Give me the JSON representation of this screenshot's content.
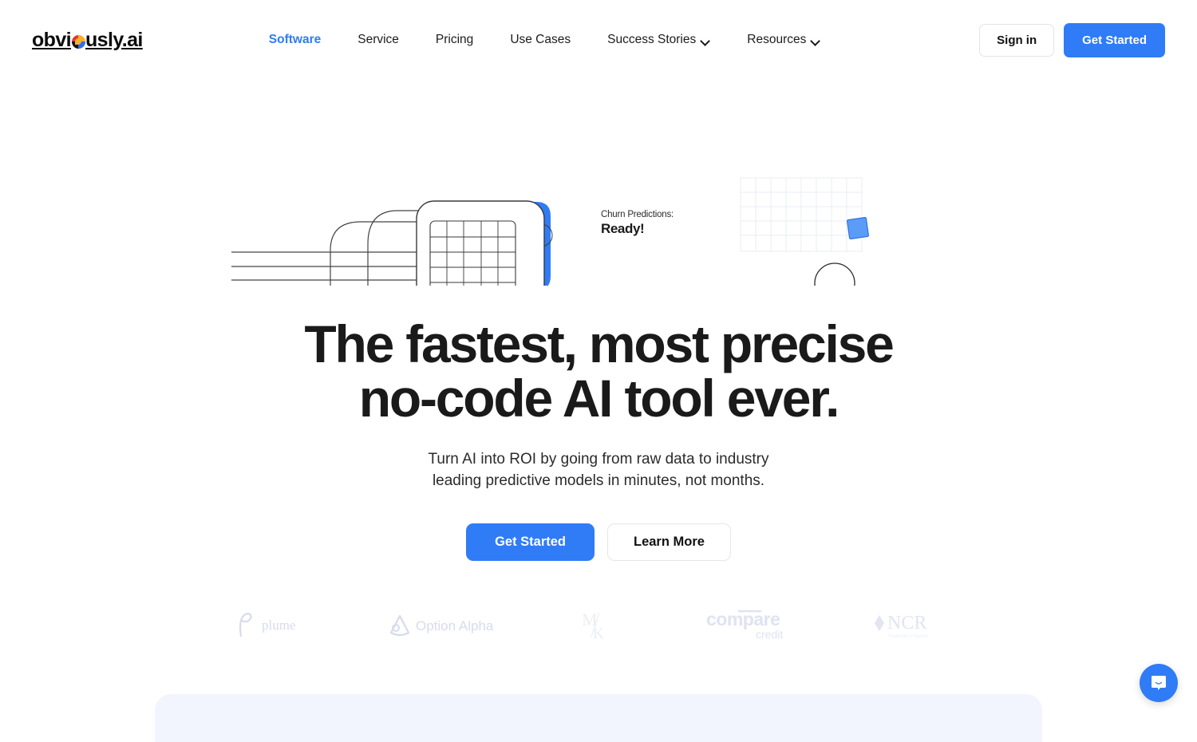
{
  "brand": {
    "text_before": "obvi",
    "mark": "colorful-circle-logomark",
    "text_after": "usly.ai",
    "full": "obviously.ai"
  },
  "nav": {
    "items": [
      {
        "label": "Software",
        "active": true,
        "has_dropdown": false
      },
      {
        "label": "Service",
        "active": false,
        "has_dropdown": false
      },
      {
        "label": "Pricing",
        "active": false,
        "has_dropdown": false
      },
      {
        "label": "Use Cases",
        "active": false,
        "has_dropdown": false
      },
      {
        "label": "Success Stories",
        "active": false,
        "has_dropdown": true
      },
      {
        "label": "Resources",
        "active": false,
        "has_dropdown": true
      }
    ]
  },
  "header_actions": {
    "signin_label": "Sign in",
    "get_started_label": "Get Started"
  },
  "illustration": {
    "screen_label": "Churn Predictions:",
    "screen_status": "Ready!",
    "status_icon": "check-circle-icon",
    "indicator_lights": [
      "off",
      "off",
      "on"
    ],
    "colors": {
      "blue": "#2f7cf6",
      "light_blue": "#8cb6f5",
      "green": "#49d17f",
      "dark": "#2b2b2b",
      "outline": "#3a3a3a"
    }
  },
  "hero": {
    "title_line1": "The fastest, most precise",
    "title_line2": "no-code AI tool ever.",
    "subtitle_line1": "Turn AI into ROI by going from raw data to industry",
    "subtitle_line2": "leading predictive models in minutes, not months.",
    "primary_cta": "Get Started",
    "secondary_cta": "Learn More"
  },
  "logos": [
    {
      "name": "plume",
      "text": "plume"
    },
    {
      "name": "option-alpha",
      "text": "Option Alpha"
    },
    {
      "name": "mk",
      "text": "M/K"
    },
    {
      "name": "compare-credit",
      "text": "compare",
      "subtext": "credit"
    },
    {
      "name": "ncr",
      "text": "NCR",
      "subtext": "Financial | Finance"
    }
  ],
  "chat": {
    "icon": "intercom-chat-icon",
    "color": "#2f7cf6"
  },
  "colors": {
    "accent": "#2f7cf6",
    "text": "#1a1a1a",
    "panel": "#f2f5fd",
    "logo_gray": "#d7dbec"
  }
}
